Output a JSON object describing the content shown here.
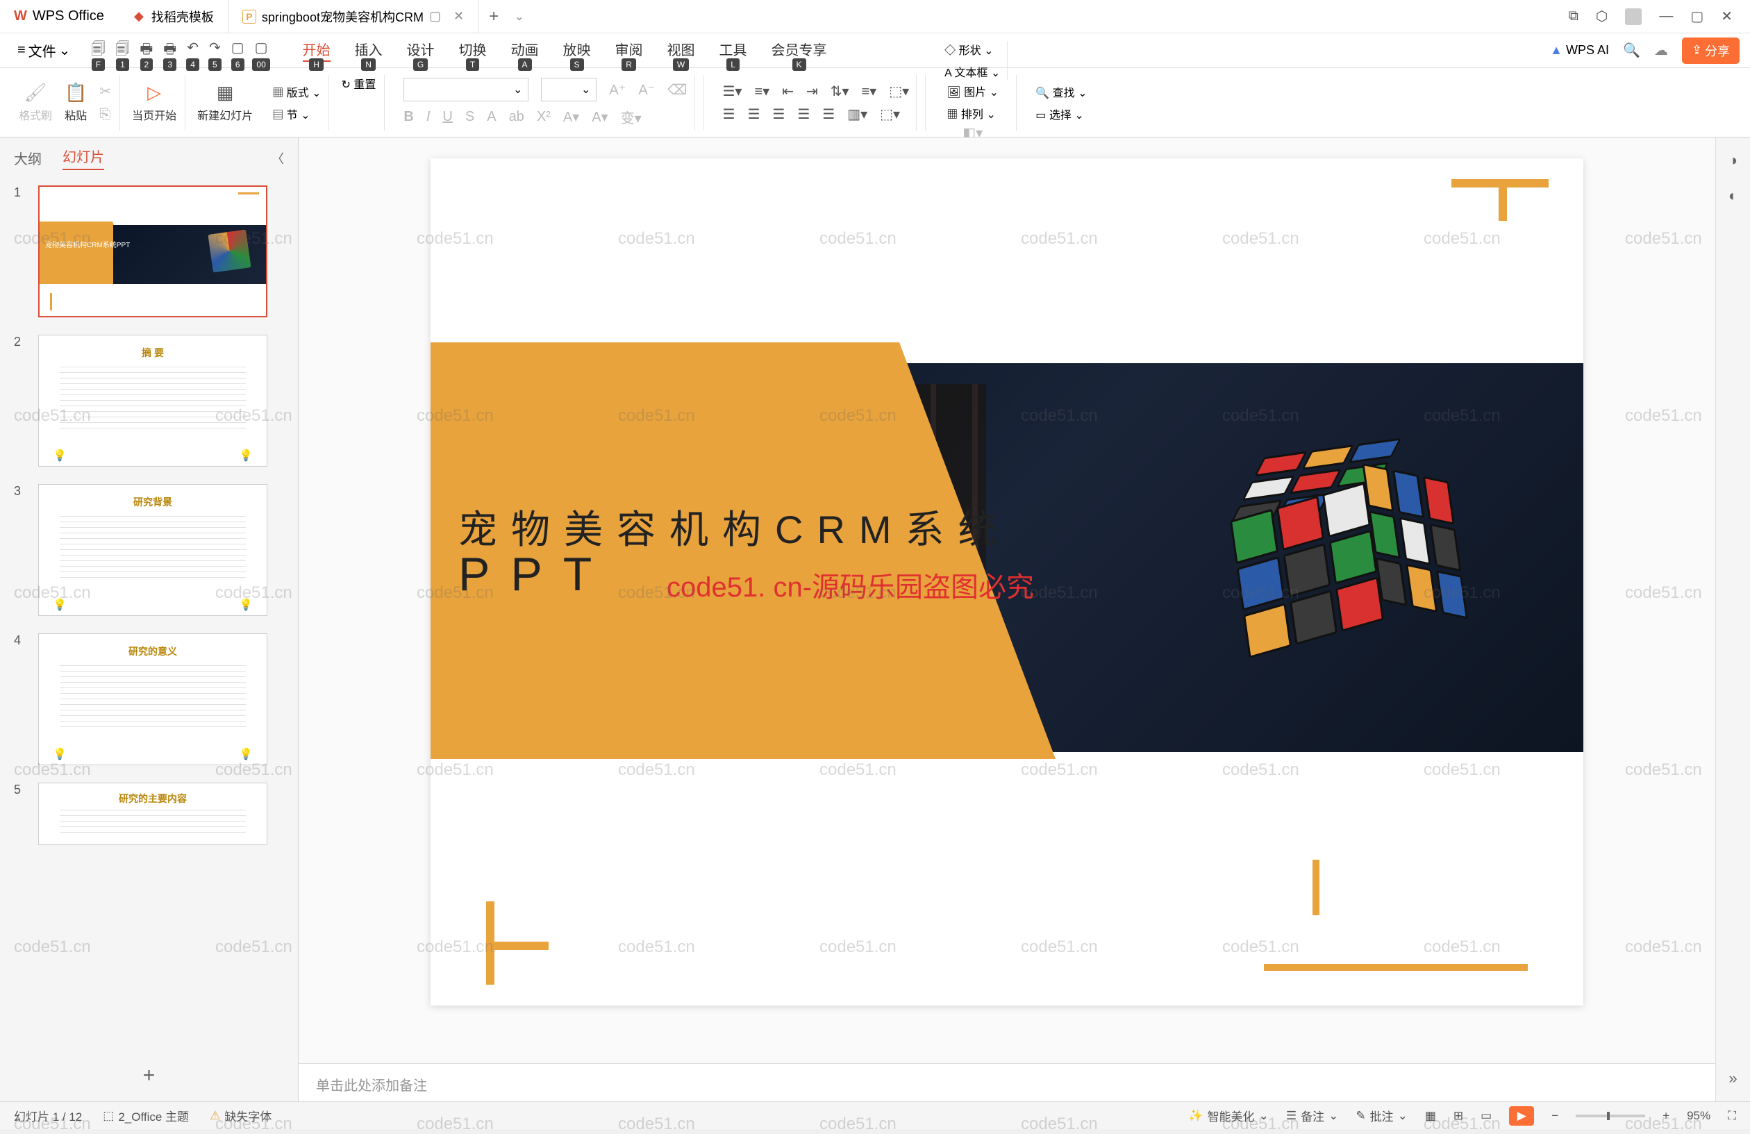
{
  "titlebar": {
    "app_name": "WPS Office",
    "tabs": [
      {
        "label": "找稻壳模板",
        "icon": "red"
      },
      {
        "label": "springboot宠物美容机构CRM",
        "icon": "orange",
        "active": true,
        "closable": true
      }
    ]
  },
  "menubar": {
    "file": "文件",
    "hints": [
      "F",
      "1",
      "2",
      "3",
      "4",
      "5",
      "6",
      "00"
    ],
    "tabs": [
      {
        "label": "开始",
        "hint": "H",
        "active": true
      },
      {
        "label": "插入",
        "hint": "N"
      },
      {
        "label": "设计",
        "hint": "G"
      },
      {
        "label": "切换",
        "hint": "T"
      },
      {
        "label": "动画",
        "hint": "A"
      },
      {
        "label": "放映",
        "hint": "S"
      },
      {
        "label": "审阅",
        "hint": "R"
      },
      {
        "label": "视图",
        "hint": "W"
      },
      {
        "label": "工具",
        "hint": "L"
      },
      {
        "label": "会员专享",
        "hint": "K"
      }
    ],
    "wps_ai": "WPS AI",
    "share": "分享"
  },
  "ribbon": {
    "format_brush": "格式刷",
    "paste": "粘贴",
    "from_current": "当页开始",
    "new_slide": "新建幻灯片",
    "layout": "版式",
    "section": "节",
    "reset": "重置",
    "shape": "形状",
    "picture": "图片",
    "textbox": "文本框",
    "arrange": "排列",
    "find": "查找",
    "select": "选择"
  },
  "sidepanel": {
    "tab_outline": "大纲",
    "tab_slides": "幻灯片",
    "slides": [
      {
        "num": "1",
        "title": "宠物美容机构CRM系统PPT"
      },
      {
        "num": "2",
        "title": "摘  要"
      },
      {
        "num": "3",
        "title": "研究背景"
      },
      {
        "num": "4",
        "title": "研究的意义"
      },
      {
        "num": "5",
        "title": "研究的主要内容"
      }
    ]
  },
  "canvas": {
    "title_line1": "宠物美容机构CRM系统",
    "title_line2": "PPT",
    "watermark": "code51. cn-源码乐园盗图必究"
  },
  "notes_placeholder": "单击此处添加备注",
  "statusbar": {
    "slide_info": "幻灯片 1 / 12",
    "theme": "2_Office 主题",
    "missing_font": "缺失字体",
    "smart_beautify": "智能美化",
    "notes_btn": "备注",
    "review_btn": "批注",
    "zoom": "95%"
  },
  "watermark_text": "code51.cn",
  "rubiks_colors": {
    "front": [
      "#2a8c3e",
      "#d93030",
      "#e8e8e8",
      "#2a5aa8",
      "#3a3a3a",
      "#2a8c3e",
      "#e8a33d",
      "#3a3a3a",
      "#d93030"
    ],
    "right": [
      "#e8a33d",
      "#2a5aa8",
      "#d93030",
      "#2a8c3e",
      "#e8e8e8",
      "#3a3a3a",
      "#3a3a3a",
      "#e8a33d",
      "#2a5aa8"
    ],
    "top": [
      "#d93030",
      "#e8a33d",
      "#2a5aa8",
      "#e8e8e8",
      "#d93030",
      "#2a8c3e",
      "#3a3a3a",
      "#2a5aa8",
      "#e8a33d"
    ]
  }
}
